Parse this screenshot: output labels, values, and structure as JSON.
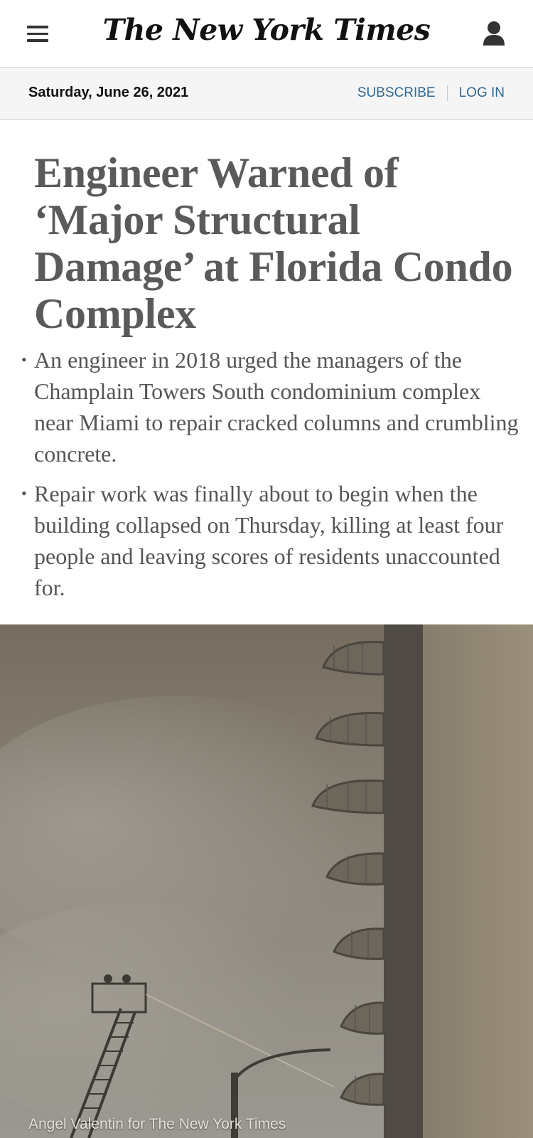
{
  "header": {
    "logo": "The New York Times",
    "menu_icon": "hamburger-menu-icon",
    "account_icon": "user-account-icon"
  },
  "datebar": {
    "date": "Saturday, June 26, 2021",
    "subscribe_label": "SUBSCRIBE",
    "login_label": "LOG IN"
  },
  "article": {
    "headline": "Engineer Warned of ‘Major Structural Damage’ at Florida Condo Complex",
    "summary": [
      "An engineer in 2018 urged the managers of the Champlain Towers South condominium complex near Miami to repair cracked columns and crumbling concrete.",
      "Repair work was finally about to begin when the building collapsed on Thursday, killing at least four people and leaving scores of residents unaccounted for."
    ],
    "photo_credit": "Angel Valentin for The New York Times"
  },
  "colors": {
    "link": "#326891",
    "headline": "#5a5a5a",
    "datebar_bg": "#f5f5f5"
  }
}
